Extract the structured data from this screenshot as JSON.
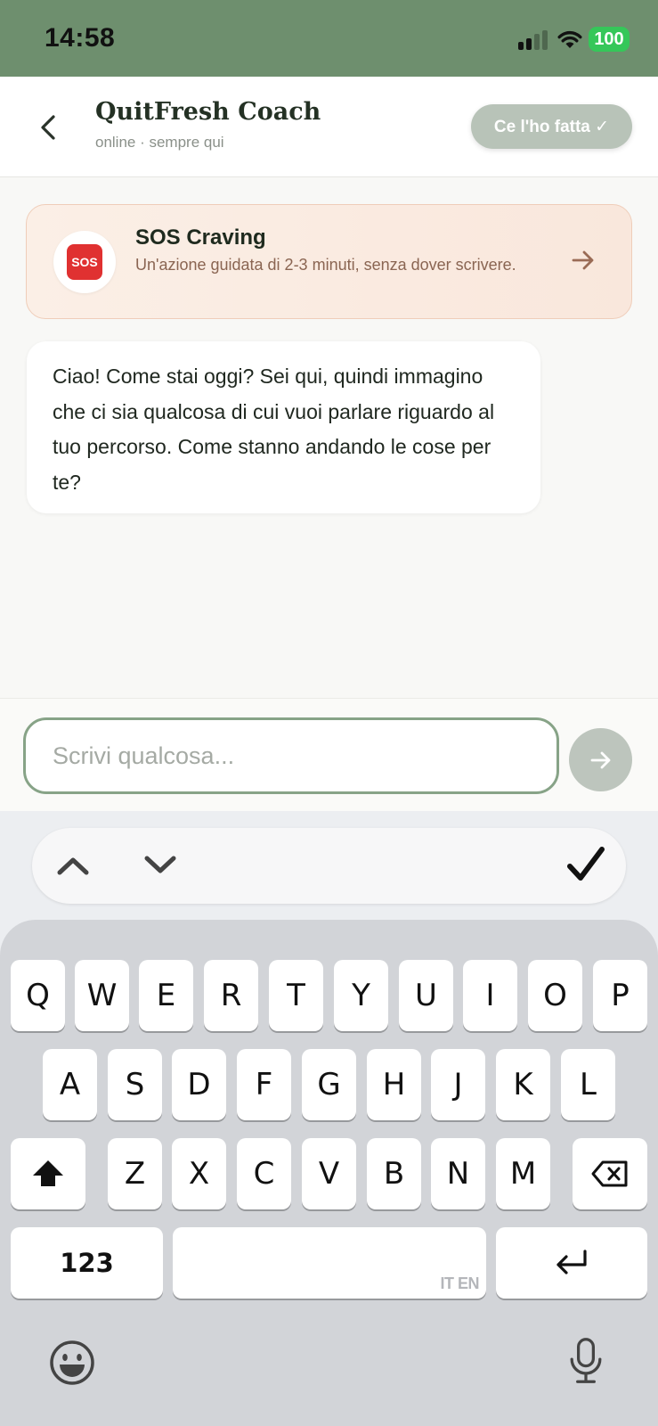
{
  "status_bar": {
    "time": "14:58",
    "battery": "100"
  },
  "header": {
    "title": "QuitFresh Coach",
    "subtitle": "online · sempre qui",
    "done_button": "Ce l'ho fatta ✓"
  },
  "sos": {
    "badge": "SOS",
    "title": "SOS Craving",
    "description": "Un'azione guidata di 2-3 minuti, senza dover scrivere."
  },
  "messages": [
    {
      "sender": "coach",
      "text": "Ciao! Come stai oggi? Sei qui, quindi immagino che ci sia qualcosa di cui vuoi parlare riguardo al tuo percorso. Come stanno andando le cose per te?"
    }
  ],
  "composer": {
    "placeholder": "Scrivi qualcosa..."
  },
  "keyboard": {
    "row1": [
      "Q",
      "W",
      "E",
      "R",
      "T",
      "Y",
      "U",
      "I",
      "O",
      "P"
    ],
    "row2": [
      "A",
      "S",
      "D",
      "F",
      "G",
      "H",
      "J",
      "K",
      "L"
    ],
    "row3": [
      "Z",
      "X",
      "C",
      "V",
      "B",
      "N",
      "M"
    ],
    "numbers_key": "123",
    "space_language": "IT EN"
  }
}
